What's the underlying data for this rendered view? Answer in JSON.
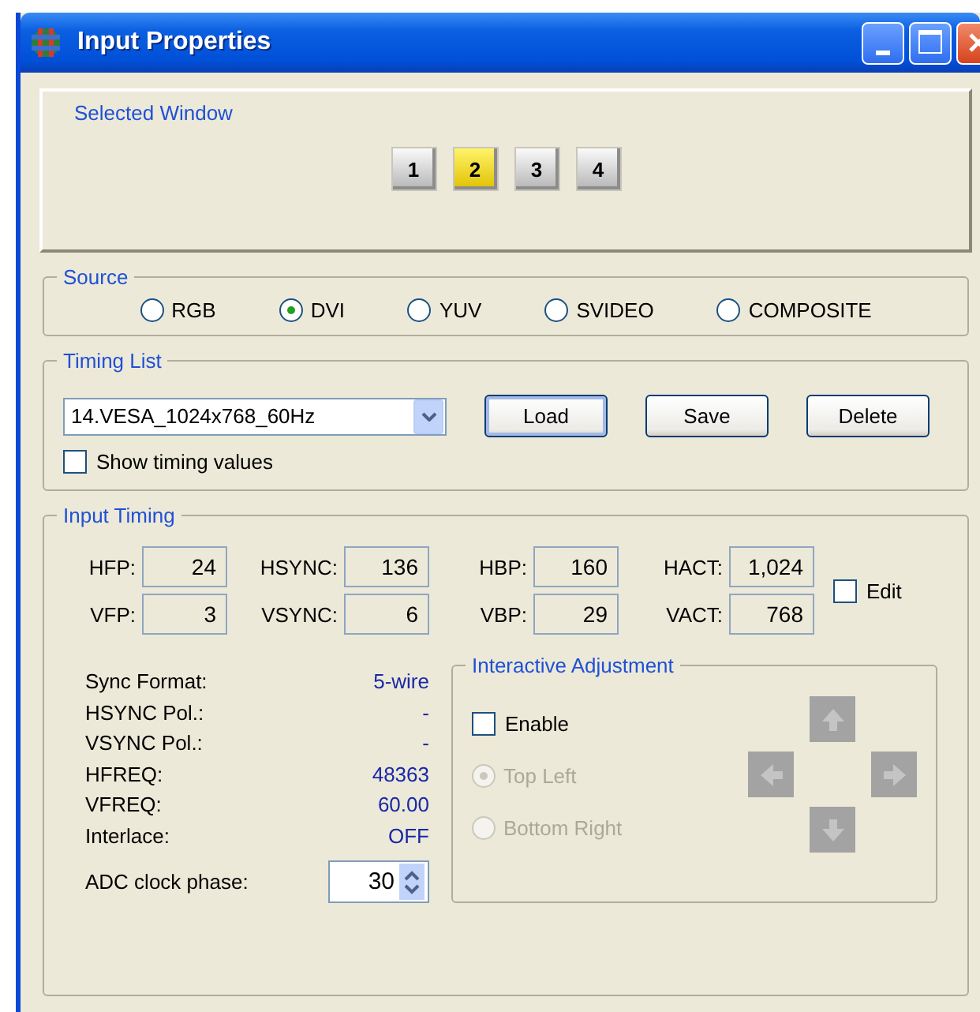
{
  "window": {
    "title": "Input Properties"
  },
  "selected_window": {
    "label": "Selected Window",
    "buttons": [
      {
        "label": "1",
        "selected": false
      },
      {
        "label": "2",
        "selected": true
      },
      {
        "label": "3",
        "selected": false
      },
      {
        "label": "4",
        "selected": false
      }
    ]
  },
  "source": {
    "legend": "Source",
    "options": [
      {
        "label": "RGB",
        "selected": false
      },
      {
        "label": "DVI",
        "selected": true
      },
      {
        "label": "YUV",
        "selected": false
      },
      {
        "label": "SVIDEO",
        "selected": false
      },
      {
        "label": "COMPOSITE",
        "selected": false
      }
    ]
  },
  "timing_list": {
    "legend": "Timing List",
    "dropdown": {
      "value": "14.VESA_1024x768_60Hz"
    },
    "buttons": [
      "Load",
      "Save",
      "Delete"
    ],
    "show_timing_values": {
      "label": "Show timing values",
      "checked": false
    }
  },
  "input_timing": {
    "legend": "Input Timing",
    "fields": [
      {
        "label": "HFP:",
        "value": "24"
      },
      {
        "label": "HSYNC:",
        "value": "136"
      },
      {
        "label": "HBP:",
        "value": "160"
      },
      {
        "label": "HACT:",
        "value": "1,024"
      },
      {
        "label": "VFP:",
        "value": "3"
      },
      {
        "label": "VSYNC:",
        "value": "6"
      },
      {
        "label": "VBP:",
        "value": "29"
      },
      {
        "label": "VACT:",
        "value": "768"
      }
    ],
    "edit": {
      "label": "Edit",
      "checked": false
    },
    "info": [
      {
        "label": "Sync Format:",
        "value": "5-wire"
      },
      {
        "label": "HSYNC Pol.:",
        "value": "-"
      },
      {
        "label": "VSYNC Pol.:",
        "value": "-"
      },
      {
        "label": "HFREQ:",
        "value": "48363"
      },
      {
        "label": "VFREQ:",
        "value": "60.00"
      },
      {
        "label": "Interlace:",
        "value": "OFF"
      }
    ],
    "adc_clock_phase": {
      "label": "ADC clock phase:",
      "value": "30"
    },
    "interactive_adjustment": {
      "legend": "Interactive Adjustment",
      "enable": {
        "label": "Enable",
        "checked": false
      },
      "options": [
        {
          "label": "Top Left",
          "selected": true,
          "disabled": true
        },
        {
          "label": "Bottom Right",
          "selected": false,
          "disabled": true
        }
      ],
      "arrows_disabled": true
    }
  }
}
